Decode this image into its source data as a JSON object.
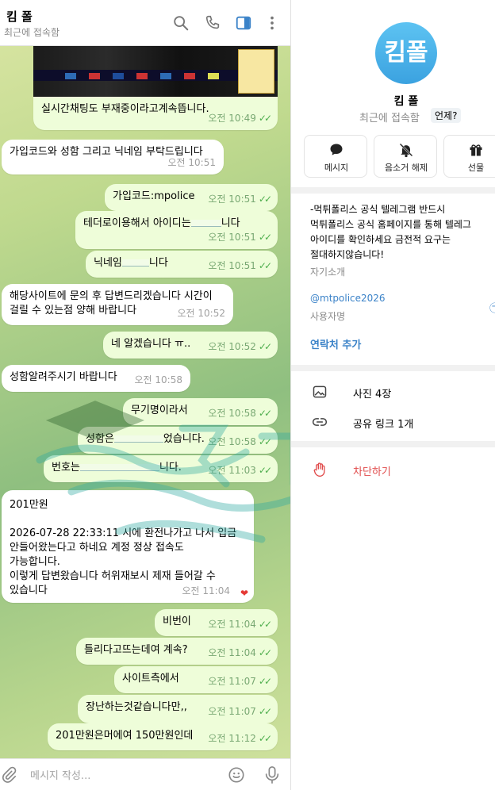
{
  "chat": {
    "title": "킴 폴",
    "status": "최근에 접속함",
    "header_icons": [
      "search-icon",
      "phone-icon",
      "sidebar-toggle-icon",
      "more-vertical-icon"
    ],
    "messages": [
      {
        "dir": "out",
        "text": "실시간채팅도 부재중이라고계속뜹니다.",
        "time": "오전 10:49",
        "read": true,
        "has_image": true
      },
      {
        "dir": "in",
        "text": "가입코드와 성함 그리고 닉네임 부탁드립니다",
        "time": "오전 10:51"
      },
      {
        "dir": "out",
        "text": "가입코드:mpolice",
        "time": "오전 10:51",
        "read": true
      },
      {
        "dir": "out",
        "text": "테더로이용해서 아이디는",
        "text_end": "니다",
        "time": "오전 10:51",
        "read": true
      },
      {
        "dir": "out",
        "text": "닉네임",
        "text_end": "니다",
        "time": "오전 10:51",
        "read": true
      },
      {
        "dir": "in",
        "text": "해당사이트에 문의 후 답변드리겠습니다 시간이\n걸릴 수 있는점 양해 바랍니다",
        "time": "오전 10:52"
      },
      {
        "dir": "out",
        "text": "네 알겠습니다 ㅠ..",
        "time": "오전 10:52",
        "read": true
      },
      {
        "dir": "in",
        "text": "성함알려주시기 바랍니다",
        "time": "오전 10:58"
      },
      {
        "dir": "out",
        "text": "무기명이라서",
        "time": "오전 10:58",
        "read": true
      },
      {
        "dir": "out",
        "text": "성함은",
        "text_end": "었습니다.",
        "time": "오전 10:58",
        "read": true
      },
      {
        "dir": "out",
        "text": "번호는",
        "text_end": "니다.",
        "time": "오전 11:03",
        "read": true
      },
      {
        "dir": "in",
        "text": "201만원\n\n2026-07-28 22:33:11 시에 환전나가고 나서 입금\n안들어왔는다고 하네요 계정 정상 접속도\n가능합니다.\n이렇게 답변왔습니다 허위재보시 제재 들어갈 수\n있습니다",
        "time": "오전 11:04",
        "reaction": "❤"
      },
      {
        "dir": "out",
        "text": "비번이",
        "time": "오전 11:04",
        "read": true
      },
      {
        "dir": "out",
        "text": "틀리다고뜨는데여 계속?",
        "time": "오전 11:04",
        "read": true
      },
      {
        "dir": "out",
        "text": "사이트측에서",
        "time": "오전 11:07",
        "read": true
      },
      {
        "dir": "out",
        "text": "장난하는것같습니다만,,",
        "time": "오전 11:07",
        "read": true
      },
      {
        "dir": "out",
        "text": "201만원은머에여 150만원인데",
        "time": "오전 11:12",
        "read": true
      }
    ],
    "composer_placeholder": "메시지 작성..."
  },
  "profile": {
    "avatar_text": "킴폴",
    "avatar_color": "#4fb3ea",
    "name": "킴 폴",
    "status": "최근에 접속함",
    "when_button": "언제?",
    "actions": [
      {
        "label": "메시지",
        "icon": "chat-bubble-icon"
      },
      {
        "label": "음소거 해제",
        "icon": "bell-muted-icon"
      },
      {
        "label": "선물",
        "icon": "gift-icon"
      }
    ],
    "bio": "-먹튀폴리스 공식 텔레그램 반드시\n먹튀폴리스 공식 홈페이지를 통해 텔레그\n아이디를 확인하세요 금전적 요구는\n절대하지않습니다!",
    "bio_caption": "자기소개",
    "username": "@mtpolice2026",
    "username_caption": "사용자명",
    "add_contact": "연락처 추가",
    "rows": [
      {
        "label": "사진 4장",
        "icon": "photo-icon"
      },
      {
        "label": "공유 링크 1개",
        "icon": "link-icon"
      }
    ],
    "block": "차단하기"
  },
  "colors": {
    "accent": "#3a82c8",
    "outgoing_bubble": "#eefdd9",
    "incoming_bubble": "#ffffff",
    "danger": "#e04b4b",
    "read_ticks": "#4fae4e"
  }
}
